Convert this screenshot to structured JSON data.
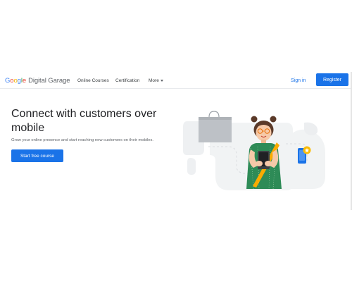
{
  "logo": {
    "google_letters": [
      {
        "ch": "G",
        "color": "#4285f4"
      },
      {
        "ch": "o",
        "color": "#ea4335"
      },
      {
        "ch": "o",
        "color": "#fbbc05"
      },
      {
        "ch": "g",
        "color": "#4285f4"
      },
      {
        "ch": "l",
        "color": "#34a853"
      },
      {
        "ch": "e",
        "color": "#ea4335"
      }
    ],
    "product": "Digital Garage"
  },
  "nav": {
    "online_courses": "Online Courses",
    "certification": "Certification",
    "more": "More"
  },
  "header": {
    "sign_in": "Sign in",
    "register": "Register"
  },
  "hero": {
    "title": "Connect with customers over mobile",
    "subtitle": "Grow your online presence and start reaching new customers on their mobiles.",
    "cta": "Start free course"
  },
  "colors": {
    "accent": "#1a73e8",
    "dress": "#2e8b57",
    "strap": "#f9ab00"
  }
}
